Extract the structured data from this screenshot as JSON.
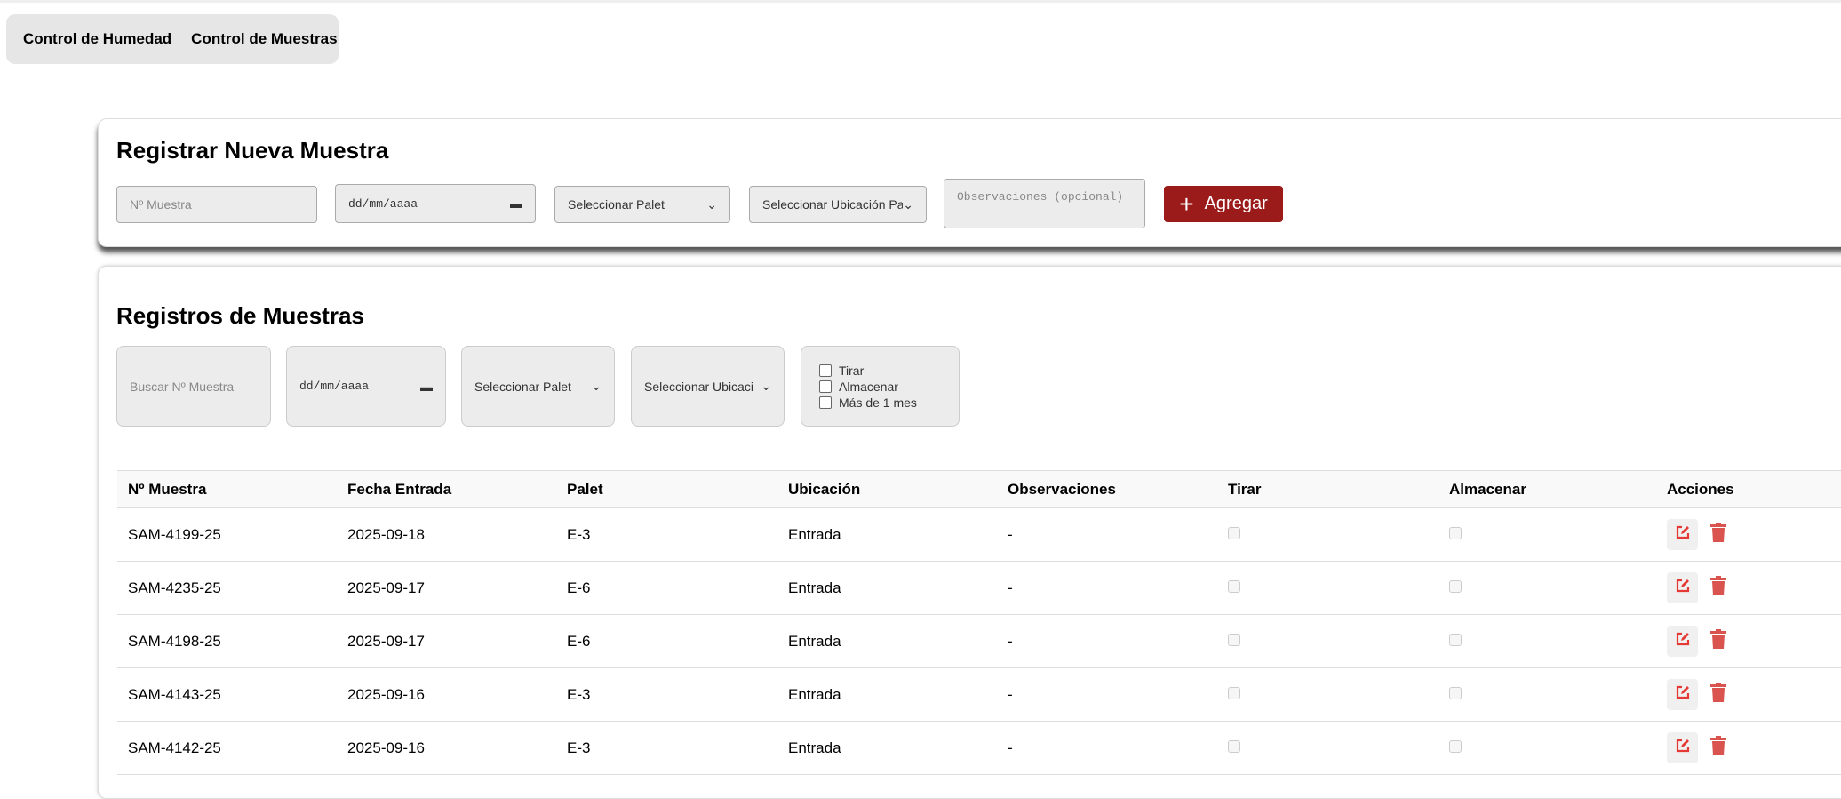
{
  "nav": {
    "items": [
      "Control de Humedad",
      "Control de Muestras"
    ]
  },
  "register": {
    "title": "Registrar Nueva Muestra",
    "sample_placeholder": "Nº Muestra",
    "date_placeholder": "dd/mm/aaaa",
    "palet_select": "Seleccionar Palet",
    "location_select": "Seleccionar Ubicación Pal",
    "observations_placeholder": "Observaciones (opcional)",
    "add_label": "Agregar",
    "accent": "#9b1a1a"
  },
  "records": {
    "title": "Registros de Muestras",
    "filters": {
      "search_placeholder": "Buscar Nº Muestra",
      "date_placeholder": "dd/mm/aaaa",
      "palet_select": "Seleccionar Palet",
      "location_select": "Seleccionar Ubicaci",
      "checks": [
        "Tirar",
        "Almacenar",
        "Más de 1 mes"
      ]
    },
    "columns": [
      "Nº Muestra",
      "Fecha Entrada",
      "Palet",
      "Ubicación",
      "Observaciones",
      "Tirar",
      "Almacenar",
      "Acciones"
    ],
    "rows": [
      {
        "id": "SAM-4199-25",
        "date": "2025-09-18",
        "palet": "E-3",
        "location": "Entrada",
        "obs": "-",
        "tirar": false,
        "almacenar": false
      },
      {
        "id": "SAM-4235-25",
        "date": "2025-09-17",
        "palet": "E-6",
        "location": "Entrada",
        "obs": "-",
        "tirar": false,
        "almacenar": false
      },
      {
        "id": "SAM-4198-25",
        "date": "2025-09-17",
        "palet": "E-6",
        "location": "Entrada",
        "obs": "-",
        "tirar": false,
        "almacenar": false
      },
      {
        "id": "SAM-4143-25",
        "date": "2025-09-16",
        "palet": "E-3",
        "location": "Entrada",
        "obs": "-",
        "tirar": false,
        "almacenar": false
      },
      {
        "id": "SAM-4142-25",
        "date": "2025-09-16",
        "palet": "E-3",
        "location": "Entrada",
        "obs": "-",
        "tirar": false,
        "almacenar": false
      }
    ]
  }
}
